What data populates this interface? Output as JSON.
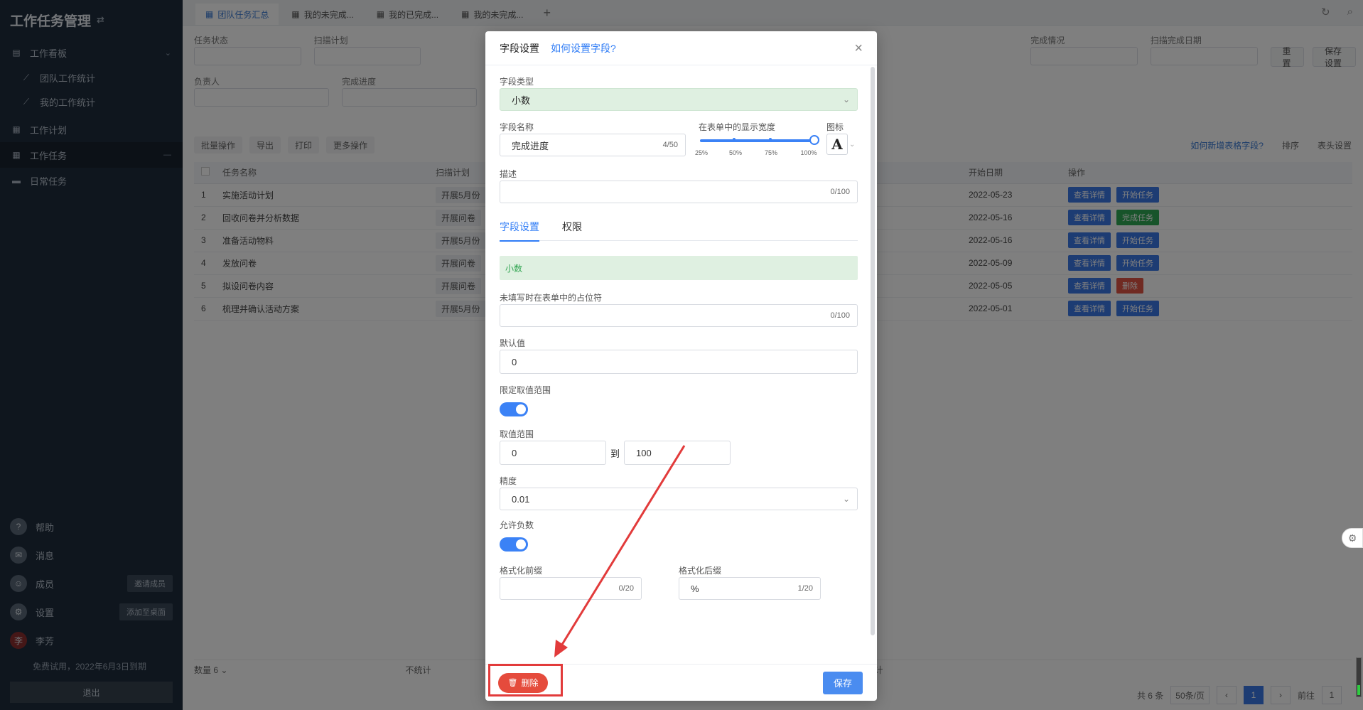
{
  "sidebar": {
    "title": "工作任务管理",
    "items": [
      {
        "label": "工作看板",
        "icon": "chart-icon"
      },
      {
        "label": "团队工作统计",
        "icon": "line-chart-icon"
      },
      {
        "label": "我的工作统计",
        "icon": "line-chart-icon"
      },
      {
        "label": "工作计划",
        "icon": "calendar-icon"
      },
      {
        "label": "工作任务",
        "icon": "task-icon"
      },
      {
        "label": "日常任务",
        "icon": "list-icon"
      }
    ],
    "bottom": [
      {
        "label": "帮助",
        "badge": ""
      },
      {
        "label": "消息",
        "badge": ""
      },
      {
        "label": "成员",
        "badge": "邀请成员"
      },
      {
        "label": "设置",
        "badge": "添加至桌面"
      },
      {
        "label": "李芳",
        "badge": ""
      }
    ],
    "trial": "免费试用，2022年6月3日到期",
    "logout": "退出"
  },
  "tabs": [
    "团队任务汇总",
    "我的未完成...",
    "我的已完成...",
    "我的未完成..."
  ],
  "filters": {
    "row1": [
      "任务状态",
      "扫描计划",
      "完成情况",
      "扫描完成日期"
    ],
    "row2": [
      "负责人",
      "完成进度"
    ],
    "reset": "重置",
    "save_filter": "保存设置"
  },
  "toolbar": {
    "batch": "批量操作",
    "export": "导出",
    "print": "打印",
    "more": "更多操作",
    "help_link": "如何新增表格字段?",
    "sort": "排序",
    "header_settings": "表头设置"
  },
  "table": {
    "headers": [
      "",
      "任务名称",
      "扫描计划",
      "",
      "开始日期",
      "操作"
    ],
    "rows": [
      {
        "n": "1",
        "name": "实施活动计划",
        "plan": "开展5月份",
        "date": "2022-05-23",
        "actions": [
          "查看详情",
          "开始任务"
        ]
      },
      {
        "n": "2",
        "name": "回收问卷并分析数据",
        "plan": "开展问卷",
        "date": "2022-05-16",
        "actions": [
          "查看详情",
          "完成任务"
        ]
      },
      {
        "n": "3",
        "name": "准备活动物料",
        "plan": "开展5月份",
        "date": "2022-05-16",
        "actions": [
          "查看详情",
          "开始任务"
        ]
      },
      {
        "n": "4",
        "name": "发放问卷",
        "plan": "开展问卷",
        "date": "2022-05-09",
        "actions": [
          "查看详情",
          "开始任务"
        ]
      },
      {
        "n": "5",
        "name": "拟设问卷内容",
        "plan": "开展问卷",
        "date": "2022-05-05",
        "actions": [
          "查看详情",
          "删除"
        ]
      },
      {
        "n": "6",
        "name": "梳理并确认活动方案",
        "plan": "开展5月份",
        "date": "2022-05-01",
        "actions": [
          "查看详情",
          "开始任务"
        ]
      }
    ],
    "footer": {
      "count_label": "数量",
      "count": "6",
      "more1": "不统计",
      "more2": "不统计"
    }
  },
  "pager": {
    "total": "共 6 条",
    "page_size": "50条/页",
    "current": "1",
    "goto": "前往",
    "goto_val": "1"
  },
  "modal": {
    "title": "字段设置",
    "help": "如何设置字段?",
    "field_type_label": "字段类型",
    "field_type_value": "小数",
    "field_name_label": "字段名称",
    "field_name_value": "完成进度",
    "field_name_count": "4/50",
    "width_label": "在表单中的显示宽度",
    "width_marks": [
      "25%",
      "50%",
      "75%",
      "100%"
    ],
    "width_value": 1.0,
    "icon_label": "图标",
    "icon_glyph": "A",
    "desc_label": "描述",
    "desc_count": "0/100",
    "tabs": [
      "字段设置",
      "权限"
    ],
    "type_banner": "小数",
    "placeholder_label": "未填写时在表单中的占位符",
    "placeholder_count": "0/100",
    "default_label": "默认值",
    "default_value": "0",
    "limit_label": "限定取值范围",
    "limit_on": true,
    "range_label": "取值范围",
    "range_min": "0",
    "range_to": "到",
    "range_max": "100",
    "precision_label": "精度",
    "precision_value": "0.01",
    "negative_label": "允许负数",
    "negative_on": true,
    "prefix_label": "格式化前缀",
    "prefix_count": "0/20",
    "suffix_label": "格式化后缀",
    "suffix_value": "%",
    "suffix_count": "1/20",
    "delete_label": "删除",
    "save_label": "保存"
  },
  "colors": {
    "accent": "#2f7cf6",
    "danger": "#e54b3c",
    "sidebar": "#1f2d3d",
    "annotation": "#e23b3b"
  }
}
